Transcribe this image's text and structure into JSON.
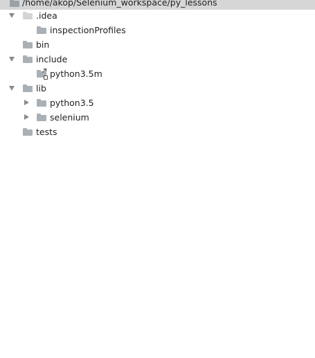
{
  "tree": {
    "root_path": "/home/akop/Selenium_workspace/py_lessons",
    "items": [
      {
        "label": ".idea",
        "icon": "folder-icon",
        "expanded": true
      },
      {
        "label": "inspectionProfiles",
        "icon": "folder-icon"
      },
      {
        "label": "bin",
        "icon": "folder-icon"
      },
      {
        "label": "include",
        "icon": "folder-icon",
        "expanded": true
      },
      {
        "label": "python3.5m",
        "icon": "symlink-folder-icon"
      },
      {
        "label": "lib",
        "icon": "folder-icon",
        "expanded": true
      },
      {
        "label": "python3.5",
        "icon": "folder-icon",
        "expanded": false
      },
      {
        "label": "selenium",
        "icon": "folder-icon",
        "expanded": false
      },
      {
        "label": "tests",
        "icon": "folder-icon"
      }
    ]
  },
  "colors": {
    "selection": "#d6d6d6",
    "folder": "#a9b0b6",
    "arrow": "#8a8a8a"
  }
}
